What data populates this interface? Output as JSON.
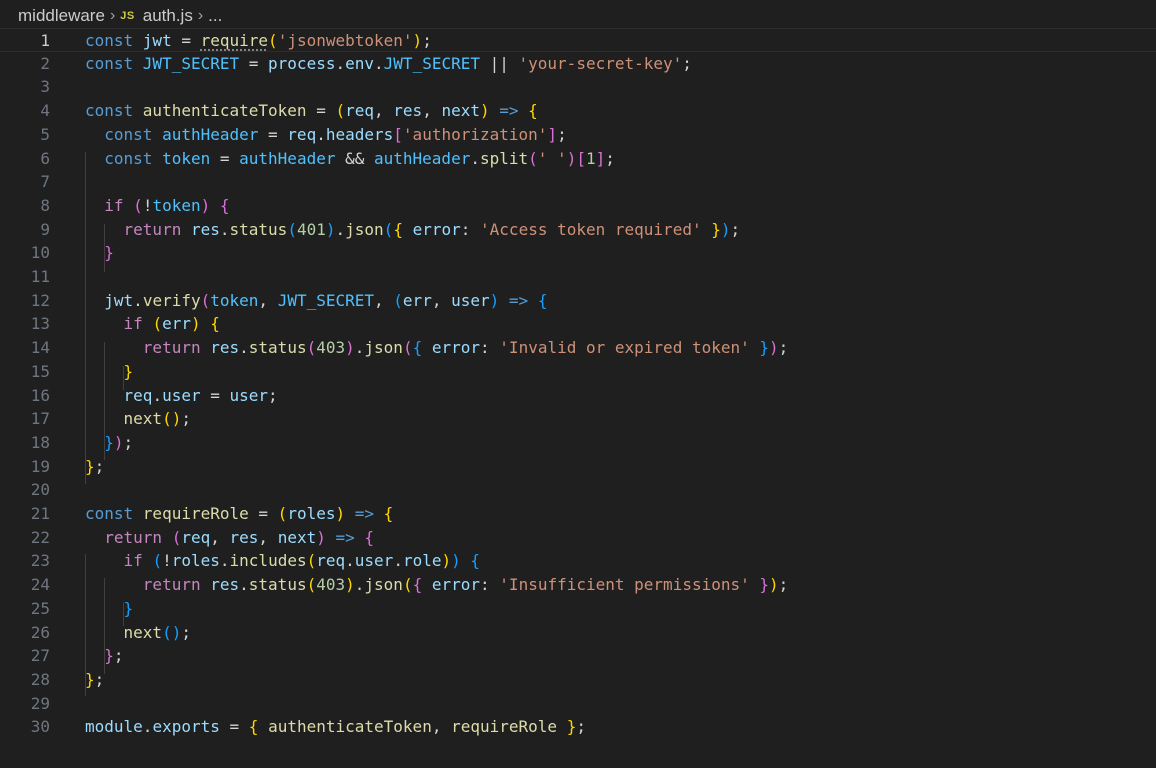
{
  "breadcrumb": {
    "folder": "middleware",
    "file_icon": "JS",
    "file": "auth.js",
    "more": "..."
  },
  "editor": {
    "current_line": 1,
    "lines": [
      [
        [
          "kw",
          "const "
        ],
        [
          "var",
          "jwt"
        ],
        [
          "op",
          " = "
        ],
        [
          "fn dotted",
          "require"
        ],
        [
          "b1",
          "("
        ],
        [
          "str",
          "'jsonwebtoken'"
        ],
        [
          "b1",
          ")"
        ],
        [
          "op",
          ";"
        ]
      ],
      [
        [
          "kw",
          "const "
        ],
        [
          "cst",
          "JWT_SECRET"
        ],
        [
          "op",
          " = "
        ],
        [
          "var",
          "process"
        ],
        [
          "op",
          "."
        ],
        [
          "var",
          "env"
        ],
        [
          "op",
          "."
        ],
        [
          "cst",
          "JWT_SECRET"
        ],
        [
          "op",
          " || "
        ],
        [
          "str",
          "'your-secret-key'"
        ],
        [
          "op",
          ";"
        ]
      ],
      [],
      [
        [
          "kw",
          "const "
        ],
        [
          "fn",
          "authenticateToken"
        ],
        [
          "op",
          " = "
        ],
        [
          "b1",
          "("
        ],
        [
          "var",
          "req"
        ],
        [
          "op",
          ", "
        ],
        [
          "var",
          "res"
        ],
        [
          "op",
          ", "
        ],
        [
          "var",
          "next"
        ],
        [
          "b1",
          ")"
        ],
        [
          "op",
          " "
        ],
        [
          "kw",
          "=>"
        ],
        [
          "op",
          " "
        ],
        [
          "b1",
          "{"
        ]
      ],
      [
        [
          "op",
          "  "
        ],
        [
          "kw",
          "const "
        ],
        [
          "cst",
          "authHeader"
        ],
        [
          "op",
          " = "
        ],
        [
          "var",
          "req"
        ],
        [
          "op",
          "."
        ],
        [
          "var",
          "headers"
        ],
        [
          "b2",
          "["
        ],
        [
          "str",
          "'authorization'"
        ],
        [
          "b2",
          "]"
        ],
        [
          "op",
          ";"
        ]
      ],
      [
        [
          "op",
          "  "
        ],
        [
          "kw",
          "const "
        ],
        [
          "cst",
          "token"
        ],
        [
          "op",
          " = "
        ],
        [
          "cst",
          "authHeader"
        ],
        [
          "op",
          " && "
        ],
        [
          "cst",
          "authHeader"
        ],
        [
          "op",
          "."
        ],
        [
          "fn",
          "split"
        ],
        [
          "b2",
          "("
        ],
        [
          "str",
          "' '"
        ],
        [
          "b2",
          ")"
        ],
        [
          "b2",
          "["
        ],
        [
          "num",
          "1"
        ],
        [
          "b2",
          "]"
        ],
        [
          "op",
          ";"
        ]
      ],
      [],
      [
        [
          "op",
          "  "
        ],
        [
          "ctl",
          "if "
        ],
        [
          "b2",
          "("
        ],
        [
          "op",
          "!"
        ],
        [
          "cst",
          "token"
        ],
        [
          "b2",
          ")"
        ],
        [
          "op",
          " "
        ],
        [
          "b2",
          "{"
        ]
      ],
      [
        [
          "op",
          "    "
        ],
        [
          "ctl",
          "return "
        ],
        [
          "var",
          "res"
        ],
        [
          "op",
          "."
        ],
        [
          "fn",
          "status"
        ],
        [
          "b3",
          "("
        ],
        [
          "num",
          "401"
        ],
        [
          "b3",
          ")"
        ],
        [
          "op",
          "."
        ],
        [
          "fn",
          "json"
        ],
        [
          "b3",
          "("
        ],
        [
          "b1",
          "{"
        ],
        [
          "op",
          " "
        ],
        [
          "var",
          "error"
        ],
        [
          "op",
          ": "
        ],
        [
          "str",
          "'Access token required'"
        ],
        [
          "op",
          " "
        ],
        [
          "b1",
          "}"
        ],
        [
          "b3",
          ")"
        ],
        [
          "op",
          ";"
        ]
      ],
      [
        [
          "op",
          "  "
        ],
        [
          "b2",
          "}"
        ]
      ],
      [],
      [
        [
          "op",
          "  "
        ],
        [
          "var",
          "jwt"
        ],
        [
          "op",
          "."
        ],
        [
          "fn",
          "verify"
        ],
        [
          "b2",
          "("
        ],
        [
          "cst",
          "token"
        ],
        [
          "op",
          ", "
        ],
        [
          "cst",
          "JWT_SECRET"
        ],
        [
          "op",
          ", "
        ],
        [
          "b3",
          "("
        ],
        [
          "var",
          "err"
        ],
        [
          "op",
          ", "
        ],
        [
          "var",
          "user"
        ],
        [
          "b3",
          ")"
        ],
        [
          "op",
          " "
        ],
        [
          "kw",
          "=>"
        ],
        [
          "op",
          " "
        ],
        [
          "b3",
          "{"
        ]
      ],
      [
        [
          "op",
          "    "
        ],
        [
          "ctl",
          "if "
        ],
        [
          "b1",
          "("
        ],
        [
          "var",
          "err"
        ],
        [
          "b1",
          ")"
        ],
        [
          "op",
          " "
        ],
        [
          "b1",
          "{"
        ]
      ],
      [
        [
          "op",
          "      "
        ],
        [
          "ctl",
          "return "
        ],
        [
          "var",
          "res"
        ],
        [
          "op",
          "."
        ],
        [
          "fn",
          "status"
        ],
        [
          "b2",
          "("
        ],
        [
          "num",
          "403"
        ],
        [
          "b2",
          ")"
        ],
        [
          "op",
          "."
        ],
        [
          "fn",
          "json"
        ],
        [
          "b2",
          "("
        ],
        [
          "b3",
          "{"
        ],
        [
          "op",
          " "
        ],
        [
          "var",
          "error"
        ],
        [
          "op",
          ": "
        ],
        [
          "str",
          "'Invalid or expired token'"
        ],
        [
          "op",
          " "
        ],
        [
          "b3",
          "}"
        ],
        [
          "b2",
          ")"
        ],
        [
          "op",
          ";"
        ]
      ],
      [
        [
          "op",
          "    "
        ],
        [
          "b1",
          "}"
        ]
      ],
      [
        [
          "op",
          "    "
        ],
        [
          "var",
          "req"
        ],
        [
          "op",
          "."
        ],
        [
          "var",
          "user"
        ],
        [
          "op",
          " = "
        ],
        [
          "var",
          "user"
        ],
        [
          "op",
          ";"
        ]
      ],
      [
        [
          "op",
          "    "
        ],
        [
          "fn",
          "next"
        ],
        [
          "b1",
          "("
        ],
        [
          "b1",
          ")"
        ],
        [
          "op",
          ";"
        ]
      ],
      [
        [
          "op",
          "  "
        ],
        [
          "b3",
          "}"
        ],
        [
          "b2",
          ")"
        ],
        [
          "op",
          ";"
        ]
      ],
      [
        [
          "b1",
          "}"
        ],
        [
          "op",
          ";"
        ]
      ],
      [],
      [
        [
          "kw",
          "const "
        ],
        [
          "fn",
          "requireRole"
        ],
        [
          "op",
          " = "
        ],
        [
          "b1",
          "("
        ],
        [
          "var",
          "roles"
        ],
        [
          "b1",
          ")"
        ],
        [
          "op",
          " "
        ],
        [
          "kw",
          "=>"
        ],
        [
          "op",
          " "
        ],
        [
          "b1",
          "{"
        ]
      ],
      [
        [
          "op",
          "  "
        ],
        [
          "ctl",
          "return "
        ],
        [
          "b2",
          "("
        ],
        [
          "var",
          "req"
        ],
        [
          "op",
          ", "
        ],
        [
          "var",
          "res"
        ],
        [
          "op",
          ", "
        ],
        [
          "var",
          "next"
        ],
        [
          "b2",
          ")"
        ],
        [
          "op",
          " "
        ],
        [
          "kw",
          "=>"
        ],
        [
          "op",
          " "
        ],
        [
          "b2",
          "{"
        ]
      ],
      [
        [
          "op",
          "    "
        ],
        [
          "ctl",
          "if "
        ],
        [
          "b3",
          "("
        ],
        [
          "op",
          "!"
        ],
        [
          "var",
          "roles"
        ],
        [
          "op",
          "."
        ],
        [
          "fn",
          "includes"
        ],
        [
          "b1",
          "("
        ],
        [
          "var",
          "req"
        ],
        [
          "op",
          "."
        ],
        [
          "var",
          "user"
        ],
        [
          "op",
          "."
        ],
        [
          "var",
          "role"
        ],
        [
          "b1",
          ")"
        ],
        [
          "b3",
          ")"
        ],
        [
          "op",
          " "
        ],
        [
          "b3",
          "{"
        ]
      ],
      [
        [
          "op",
          "      "
        ],
        [
          "ctl",
          "return "
        ],
        [
          "var",
          "res"
        ],
        [
          "op",
          "."
        ],
        [
          "fn",
          "status"
        ],
        [
          "b1",
          "("
        ],
        [
          "num",
          "403"
        ],
        [
          "b1",
          ")"
        ],
        [
          "op",
          "."
        ],
        [
          "fn",
          "json"
        ],
        [
          "b1",
          "("
        ],
        [
          "b2",
          "{"
        ],
        [
          "op",
          " "
        ],
        [
          "var",
          "error"
        ],
        [
          "op",
          ": "
        ],
        [
          "str",
          "'Insufficient permissions'"
        ],
        [
          "op",
          " "
        ],
        [
          "b2",
          "}"
        ],
        [
          "b1",
          ")"
        ],
        [
          "op",
          ";"
        ]
      ],
      [
        [
          "op",
          "    "
        ],
        [
          "b3",
          "}"
        ]
      ],
      [
        [
          "op",
          "    "
        ],
        [
          "fn",
          "next"
        ],
        [
          "b3",
          "("
        ],
        [
          "b3",
          ")"
        ],
        [
          "op",
          ";"
        ]
      ],
      [
        [
          "op",
          "  "
        ],
        [
          "b2",
          "}"
        ],
        [
          "op",
          ";"
        ]
      ],
      [
        [
          "b1",
          "}"
        ],
        [
          "op",
          ";"
        ]
      ],
      [],
      [
        [
          "var",
          "module"
        ],
        [
          "op",
          "."
        ],
        [
          "var",
          "exports"
        ],
        [
          "op",
          " = "
        ],
        [
          "b1",
          "{"
        ],
        [
          "op",
          " "
        ],
        [
          "fn",
          "authenticateToken"
        ],
        [
          "op",
          ", "
        ],
        [
          "fn",
          "requireRole"
        ],
        [
          "op",
          " "
        ],
        [
          "b1",
          "}"
        ],
        [
          "op",
          ";"
        ]
      ]
    ]
  }
}
